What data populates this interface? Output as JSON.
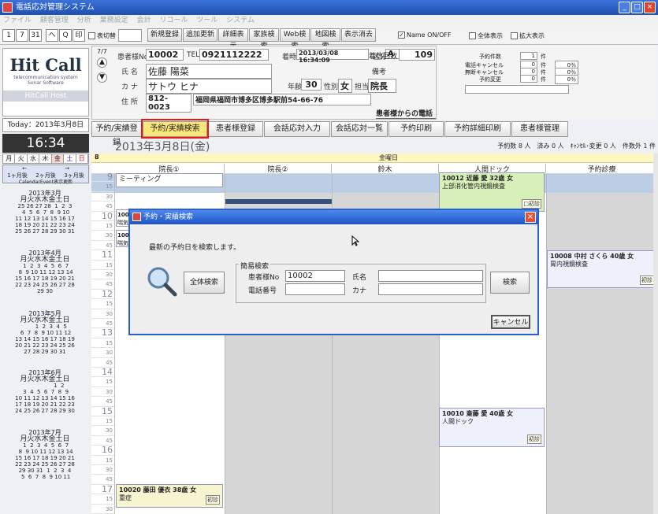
{
  "window": {
    "title": "電話応対管理システム",
    "buttons": [
      "_",
      "□",
      "×"
    ]
  },
  "menu": [
    "ファイル",
    "顧客管理",
    "分析",
    "業務設定",
    "会計",
    "リコール",
    "ツール",
    "システム"
  ],
  "toolbar": {
    "toggle_label": "表切替",
    "new": "新規登録",
    "add": "追加更新",
    "detail": "詳細表示",
    "family": "家族検索",
    "web": "Web検索",
    "map": "地図検索",
    "clear": "表示消去",
    "name_onoff": "Name ON/OFF",
    "all_display": "全体表示",
    "enlarge": "拡大表示",
    "icons": [
      "1",
      "7",
      "31",
      "ヘ",
      "Q",
      "印"
    ]
  },
  "logo": {
    "title": "Hit Call",
    "sub1": "telecommunication system",
    "sub2": "Sonar Software",
    "host": "HitCall Host"
  },
  "today": "Today：2013年3月8日",
  "clock": "16:34",
  "weekdays": [
    "月",
    "火",
    "水",
    "木",
    "金",
    "土",
    "日"
  ],
  "nav": {
    "prev": "←",
    "next": "→",
    "opts": [
      "1ヶ月後",
      "2ヶ月後",
      "3ヶ月後"
    ],
    "cal_btn": "CalendarEvent表示更新"
  },
  "minicals": [
    {
      "title": "2013年3月",
      "wd": "月火水木金土日",
      "rows": [
        "25 26 27 28  1  2  3",
        " 4  5  6  7  8  9 10",
        "11 12 13 14 15 16 17",
        "18 19 20 21 22 23 24",
        "25 26 27 28 29 30 31"
      ]
    },
    {
      "title": "2013年4月",
      "wd": "月火水木金土日",
      "rows": [
        " 1  2  3  4  5  6  7",
        " 8  9 10 11 12 13 14",
        "15 16 17 18 19 20 21",
        "22 23 24 25 26 27 28",
        "29 30"
      ]
    },
    {
      "title": "2013年5月",
      "wd": "月火水木金土日",
      "rows": [
        "       1  2  3  4  5",
        " 6  7  8  9 10 11 12",
        "13 14 15 16 17 18 19",
        "20 21 22 23 24 25 26",
        "27 28 29 30 31"
      ]
    },
    {
      "title": "2013年6月",
      "wd": "月火水木金土日",
      "rows": [
        "                1  2",
        " 3  4  5  6  7  8  9",
        "10 11 12 13 14 15 16",
        "17 18 19 20 21 22 23",
        "24 25 26 27 28 29 30"
      ]
    },
    {
      "title": "2013年7月",
      "wd": "月火水木金土日",
      "rows": [
        " 1  2  3  4  5  6  7",
        " 8  9 10 11 12 13 14",
        "15 16 17 18 19 20 21",
        "22 23 24 25 26 27 28",
        "29 30 31  1  2  3  4",
        " 5  6  7  8  9 10 11"
      ]
    }
  ],
  "patient": {
    "no_label": "患者様No",
    "no": "10002",
    "tel_label": "TEL",
    "tel": "0921112222",
    "arrival_label": "着時",
    "arrival": "2013/03/08 16:34:09",
    "kubun_label": "区分",
    "kubun": "A",
    "name_label": "氏 名",
    "name": "佐藤 陽菜",
    "bikou_label": "備考",
    "kana_label": "カ ナ",
    "kana": "サトウ ヒナ",
    "age_label": "年齢",
    "age": "30",
    "sex_label": "性別",
    "sex": "女",
    "tanto_label": "担当",
    "tanto": "院長",
    "addr_label": "住 所",
    "zip": "812-0023",
    "addr": "福岡県福岡市博多区博多駅前54-66-76",
    "from": "患者様からの電話",
    "count_label": "着信回数",
    "count": "109",
    "arrows": "7/7"
  },
  "stats": [
    {
      "label": "予約件数",
      "val": "1",
      "unit": "件",
      "pct": ""
    },
    {
      "label": "電話キャンセル",
      "val": "0",
      "unit": "件",
      "pct": "0％"
    },
    {
      "label": "無断キャンセル",
      "val": "0",
      "unit": "件",
      "pct": "0％"
    },
    {
      "label": "予約変更",
      "val": "0",
      "unit": "件",
      "pct": "0％"
    }
  ],
  "tabs": [
    "予約/実績登録",
    "予約/実績検索",
    "患者様登録",
    "会話応対入力",
    "会話応対一覧",
    "予約印刷",
    "予約詳細印刷",
    "患者様管理"
  ],
  "datebar": {
    "date": "2013年3月8日(金)",
    "summary": "予約数 8 人　済み 0 人　ｷｬﾝｾﾙ･変更 0 人　件数外 1 件"
  },
  "schedule": {
    "week_no": "8",
    "day_label": "金曜日",
    "columns": [
      "院長①",
      "院長②",
      "鈴木",
      "人間ドック",
      "予約診療"
    ],
    "times": [
      "9",
      "15",
      "30",
      "45",
      "10",
      "15",
      "30",
      "45",
      "11",
      "15",
      "30",
      "45",
      "12",
      "15",
      "30",
      "45",
      "13",
      "15",
      "30",
      "45",
      "14",
      "15",
      "30",
      "45",
      "15",
      "15",
      "30",
      "45",
      "16",
      "15",
      "30",
      "45",
      "17",
      "15",
      "30"
    ]
  },
  "appts": {
    "meeting": "ミーティング",
    "a1_title": "10012 近藤 愛 32歳 女",
    "a1_sub": "上部消化管内視鏡検査",
    "a2_title": "10008 中村 さくら 40歳 女",
    "a2_sub": "胃内視鏡検査",
    "a3_title": "10010 斎藤 愛 40歳 女",
    "a3_sub": "人間ドック",
    "a4_title": "10020 藤田 優衣 38歳 女",
    "a4_sub": "重症",
    "partial1": "1000",
    "partial1b": "喘気",
    "partial2": "1002",
    "partial2b": "喘気",
    "tag1": "□初診",
    "tag2": "初診"
  },
  "dialog": {
    "title": "予約・実績検索",
    "message": "最新の予約日を検索します。",
    "group": "簡易検索",
    "all_search": "全体検索",
    "no_label": "患者様No",
    "no_value": "10002",
    "tel_label": "電話番号",
    "name_label": "氏名",
    "kana_label": "カナ",
    "search": "検索",
    "cancel": "キャンセル"
  },
  "colors": {
    "accent": "#2a5fd0",
    "highlight": "#e31818",
    "tab_active": "#fbe67a"
  }
}
